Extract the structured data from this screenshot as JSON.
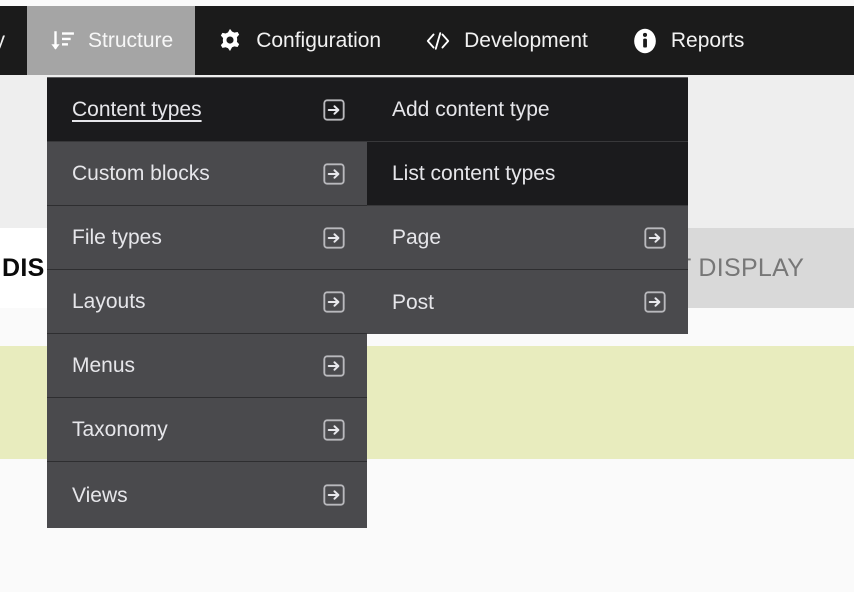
{
  "navbar": {
    "items": [
      {
        "label": "ity",
        "icon": "none",
        "active": false,
        "clipped": true
      },
      {
        "label": "Structure",
        "icon": "sort-descending-icon",
        "active": true,
        "clipped": false
      },
      {
        "label": "Configuration",
        "icon": "gear-icon",
        "active": false,
        "clipped": false
      },
      {
        "label": "Development",
        "icon": "code-brackets-icon",
        "active": false,
        "clipped": false
      },
      {
        "label": "Reports",
        "icon": "info-circle-icon",
        "active": false,
        "clipped": false
      }
    ]
  },
  "menu_level_1": {
    "items": [
      {
        "label": "Content types",
        "has_arrow": true,
        "state": "open"
      },
      {
        "label": "Custom blocks",
        "has_arrow": true,
        "state": "normal"
      },
      {
        "label": "File types",
        "has_arrow": true,
        "state": "normal"
      },
      {
        "label": "Layouts",
        "has_arrow": true,
        "state": "normal"
      },
      {
        "label": "Menus",
        "has_arrow": true,
        "state": "normal"
      },
      {
        "label": "Taxonomy",
        "has_arrow": true,
        "state": "normal"
      },
      {
        "label": "Views",
        "has_arrow": true,
        "state": "normal"
      }
    ]
  },
  "menu_level_2": {
    "items": [
      {
        "label": "Add content type",
        "has_arrow": false,
        "state": "flat"
      },
      {
        "label": "List content types",
        "has_arrow": false,
        "state": "flat"
      },
      {
        "label": "Page",
        "has_arrow": true,
        "state": "normal"
      },
      {
        "label": "Post",
        "has_arrow": true,
        "state": "normal"
      }
    ]
  },
  "background": {
    "tab_left_label": "DIS",
    "tab_right_label": "T DISPLAY"
  },
  "colors": {
    "navbar_bg": "#1b1b1b",
    "active_tab_bg": "#a5a5a5",
    "menu_bg": "#4a4a4d",
    "menu_active_bg": "#1b1b1d",
    "olive_band": "#e8ecbe",
    "page_bg": "#fafafa",
    "tab_bg": "#d9d9d9"
  }
}
